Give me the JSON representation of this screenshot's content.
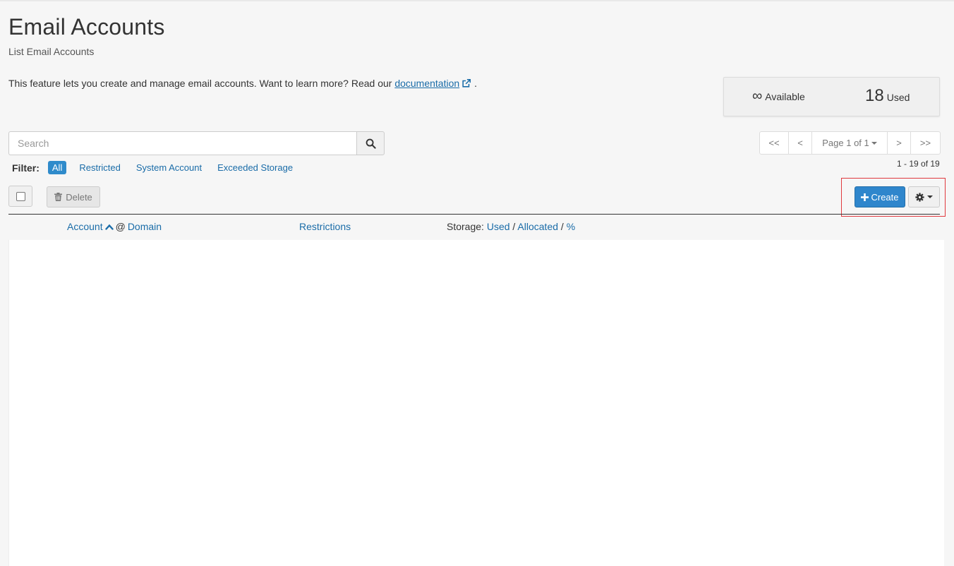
{
  "header": {
    "title": "Email Accounts",
    "subtitle": "List Email Accounts"
  },
  "intro": {
    "text": "This feature lets you create and manage email accounts. Want to learn more? Read our",
    "link_label": "documentation",
    "suffix": "."
  },
  "stats": {
    "available_value": "∞",
    "available_label": "Available",
    "used_value": "18",
    "used_label": "Used"
  },
  "search": {
    "placeholder": "Search",
    "value": ""
  },
  "filter": {
    "label": "Filter:",
    "options": [
      "All",
      "Restricted",
      "System Account",
      "Exceeded Storage"
    ],
    "selected": "All"
  },
  "pagination": {
    "first": "<<",
    "prev": "<",
    "page_label": "Page 1 of 1",
    "next": ">",
    "last": ">>",
    "count_text": "1 - 19 of 19"
  },
  "toolbar": {
    "delete_label": "Delete",
    "create_label": "Create"
  },
  "table": {
    "col_account": "Account",
    "col_at": "@",
    "col_domain": "Domain",
    "col_restrictions": "Restrictions",
    "storage_prefix": "Storage:",
    "storage_used": "Used",
    "storage_slash1": "/",
    "storage_allocated": "Allocated",
    "storage_slash2": "/",
    "storage_percent": "%"
  },
  "colors": {
    "primary": "#2f86cc",
    "link": "#1a6ca8",
    "highlight": "#e0393e"
  }
}
